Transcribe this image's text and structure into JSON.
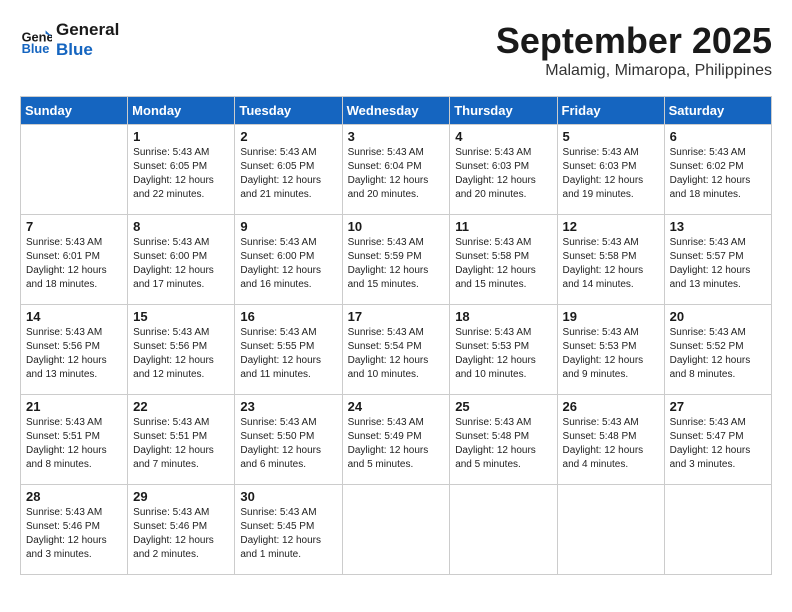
{
  "logo": {
    "line1": "General",
    "line2": "Blue"
  },
  "title": "September 2025",
  "location": "Malamig, Mimaropa, Philippines",
  "days_of_week": [
    "Sunday",
    "Monday",
    "Tuesday",
    "Wednesday",
    "Thursday",
    "Friday",
    "Saturday"
  ],
  "weeks": [
    [
      {
        "day": "",
        "info": ""
      },
      {
        "day": "1",
        "info": "Sunrise: 5:43 AM\nSunset: 6:05 PM\nDaylight: 12 hours\nand 22 minutes."
      },
      {
        "day": "2",
        "info": "Sunrise: 5:43 AM\nSunset: 6:05 PM\nDaylight: 12 hours\nand 21 minutes."
      },
      {
        "day": "3",
        "info": "Sunrise: 5:43 AM\nSunset: 6:04 PM\nDaylight: 12 hours\nand 20 minutes."
      },
      {
        "day": "4",
        "info": "Sunrise: 5:43 AM\nSunset: 6:03 PM\nDaylight: 12 hours\nand 20 minutes."
      },
      {
        "day": "5",
        "info": "Sunrise: 5:43 AM\nSunset: 6:03 PM\nDaylight: 12 hours\nand 19 minutes."
      },
      {
        "day": "6",
        "info": "Sunrise: 5:43 AM\nSunset: 6:02 PM\nDaylight: 12 hours\nand 18 minutes."
      }
    ],
    [
      {
        "day": "7",
        "info": "Sunrise: 5:43 AM\nSunset: 6:01 PM\nDaylight: 12 hours\nand 18 minutes."
      },
      {
        "day": "8",
        "info": "Sunrise: 5:43 AM\nSunset: 6:00 PM\nDaylight: 12 hours\nand 17 minutes."
      },
      {
        "day": "9",
        "info": "Sunrise: 5:43 AM\nSunset: 6:00 PM\nDaylight: 12 hours\nand 16 minutes."
      },
      {
        "day": "10",
        "info": "Sunrise: 5:43 AM\nSunset: 5:59 PM\nDaylight: 12 hours\nand 15 minutes."
      },
      {
        "day": "11",
        "info": "Sunrise: 5:43 AM\nSunset: 5:58 PM\nDaylight: 12 hours\nand 15 minutes."
      },
      {
        "day": "12",
        "info": "Sunrise: 5:43 AM\nSunset: 5:58 PM\nDaylight: 12 hours\nand 14 minutes."
      },
      {
        "day": "13",
        "info": "Sunrise: 5:43 AM\nSunset: 5:57 PM\nDaylight: 12 hours\nand 13 minutes."
      }
    ],
    [
      {
        "day": "14",
        "info": "Sunrise: 5:43 AM\nSunset: 5:56 PM\nDaylight: 12 hours\nand 13 minutes."
      },
      {
        "day": "15",
        "info": "Sunrise: 5:43 AM\nSunset: 5:56 PM\nDaylight: 12 hours\nand 12 minutes."
      },
      {
        "day": "16",
        "info": "Sunrise: 5:43 AM\nSunset: 5:55 PM\nDaylight: 12 hours\nand 11 minutes."
      },
      {
        "day": "17",
        "info": "Sunrise: 5:43 AM\nSunset: 5:54 PM\nDaylight: 12 hours\nand 10 minutes."
      },
      {
        "day": "18",
        "info": "Sunrise: 5:43 AM\nSunset: 5:53 PM\nDaylight: 12 hours\nand 10 minutes."
      },
      {
        "day": "19",
        "info": "Sunrise: 5:43 AM\nSunset: 5:53 PM\nDaylight: 12 hours\nand 9 minutes."
      },
      {
        "day": "20",
        "info": "Sunrise: 5:43 AM\nSunset: 5:52 PM\nDaylight: 12 hours\nand 8 minutes."
      }
    ],
    [
      {
        "day": "21",
        "info": "Sunrise: 5:43 AM\nSunset: 5:51 PM\nDaylight: 12 hours\nand 8 minutes."
      },
      {
        "day": "22",
        "info": "Sunrise: 5:43 AM\nSunset: 5:51 PM\nDaylight: 12 hours\nand 7 minutes."
      },
      {
        "day": "23",
        "info": "Sunrise: 5:43 AM\nSunset: 5:50 PM\nDaylight: 12 hours\nand 6 minutes."
      },
      {
        "day": "24",
        "info": "Sunrise: 5:43 AM\nSunset: 5:49 PM\nDaylight: 12 hours\nand 5 minutes."
      },
      {
        "day": "25",
        "info": "Sunrise: 5:43 AM\nSunset: 5:48 PM\nDaylight: 12 hours\nand 5 minutes."
      },
      {
        "day": "26",
        "info": "Sunrise: 5:43 AM\nSunset: 5:48 PM\nDaylight: 12 hours\nand 4 minutes."
      },
      {
        "day": "27",
        "info": "Sunrise: 5:43 AM\nSunset: 5:47 PM\nDaylight: 12 hours\nand 3 minutes."
      }
    ],
    [
      {
        "day": "28",
        "info": "Sunrise: 5:43 AM\nSunset: 5:46 PM\nDaylight: 12 hours\nand 3 minutes."
      },
      {
        "day": "29",
        "info": "Sunrise: 5:43 AM\nSunset: 5:46 PM\nDaylight: 12 hours\nand 2 minutes."
      },
      {
        "day": "30",
        "info": "Sunrise: 5:43 AM\nSunset: 5:45 PM\nDaylight: 12 hours\nand 1 minute."
      },
      {
        "day": "",
        "info": ""
      },
      {
        "day": "",
        "info": ""
      },
      {
        "day": "",
        "info": ""
      },
      {
        "day": "",
        "info": ""
      }
    ]
  ]
}
